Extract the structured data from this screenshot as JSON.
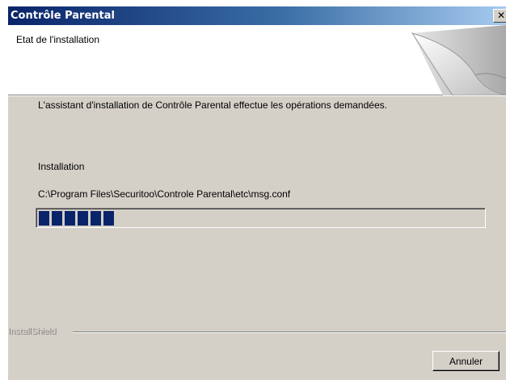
{
  "window": {
    "title": "Contrôle Parental",
    "close_glyph": "✕"
  },
  "header": {
    "title": "Etat de l'installation",
    "graphic_icon": "page-curl-icon"
  },
  "body": {
    "description": "L'assistant d'installation de Contrôle Parental effectue les opérations demandées.",
    "status_label": "Installation",
    "file_path": "C:\\Program Files\\Securitoo\\Controle Parental\\etc\\msg.conf",
    "progress": 0.18
  },
  "footer": {
    "brand": "InstallShield",
    "cancel_label": "Annuler"
  },
  "colors": {
    "title_gradient_start": "#0a246a",
    "title_gradient_end": "#a6caf0",
    "progress_fill": "#0a246a",
    "dialog_background": "#d4d0c8"
  }
}
